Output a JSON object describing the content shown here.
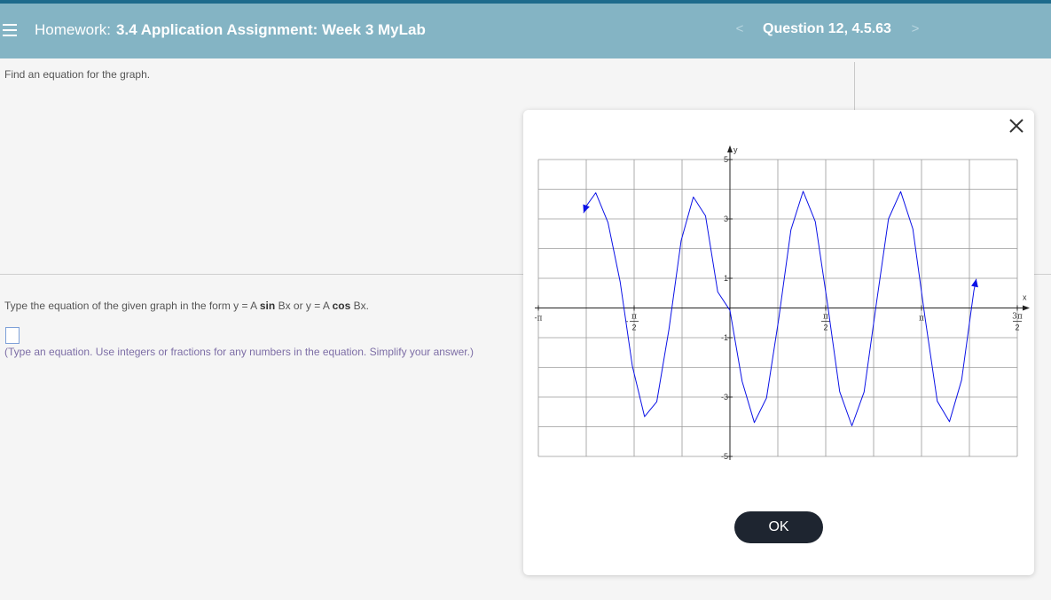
{
  "header": {
    "prefix": "Homework:",
    "assignment": "3.4 Application Assignment: Week 3 MyLab",
    "question": "Question 12, 4.5.63",
    "menu_icon": "hamburger-menu-icon",
    "prev_icon": "chevron-left-icon",
    "next_icon": "chevron-right-icon",
    "prev_glyph": "<",
    "next_glyph": ">"
  },
  "instruction": "Find an equation for the graph.",
  "prompt": {
    "before": "Type the equation of the given graph in the form y = A",
    "sin": "sin",
    "middle": "Bx or y = A",
    "cos": "cos",
    "after": "Bx."
  },
  "answer": {
    "value": ""
  },
  "hint": "(Type an equation. Use integers or fractions for any numbers in the equation. Simplify your answer.)",
  "modal": {
    "ok_label": "OK",
    "close_icon": "close-icon"
  },
  "colors": {
    "header": "#84b4c4",
    "curve": "#0b12e6",
    "ok_button": "#1e2530"
  },
  "chart_data": {
    "type": "line",
    "xlabel": "x",
    "ylabel": "y",
    "xlim": [
      "-π",
      "3π/2"
    ],
    "xlim_numeric": [
      -3.1416,
      4.7124
    ],
    "ylim": [
      -5,
      5
    ],
    "grid": true,
    "x_ticks": [
      {
        "value": -3.1416,
        "num": "π",
        "den": "",
        "sign": "-"
      },
      {
        "value": -1.5708,
        "num": "π",
        "den": "2",
        "sign": "-"
      },
      {
        "value": 1.5708,
        "num": "π",
        "den": "2",
        "sign": ""
      },
      {
        "value": 3.1416,
        "num": "π",
        "den": "",
        "sign": ""
      },
      {
        "value": 4.7124,
        "num": "3π",
        "den": "2",
        "sign": ""
      }
    ],
    "y_ticks": [
      {
        "value": 5,
        "label": "5"
      },
      {
        "value": 3,
        "label": "3"
      },
      {
        "value": 1,
        "label": "1"
      },
      {
        "value": -1,
        "label": "-1"
      },
      {
        "value": -3,
        "label": "-3"
      },
      {
        "value": -5,
        "label": "-5"
      }
    ],
    "series": [
      {
        "color": "#0b12e6",
        "x": [
          -2.4,
          -2.36,
          -2.2,
          -2.0,
          -1.8,
          -1.6,
          -1.4,
          -1.2,
          -1.0,
          -0.8,
          -0.6,
          -0.4,
          -0.2,
          0,
          0.2,
          0.4,
          0.6,
          0.8,
          1.0,
          1.2,
          1.4,
          1.6,
          1.8,
          2.0,
          2.2,
          2.4,
          2.6,
          2.8,
          3.0,
          3.2,
          3.4,
          3.6,
          3.8,
          4.0,
          4.04
        ],
        "y": [
          3.2,
          3.42,
          3.88,
          2.88,
          0.88,
          -1.96,
          -3.66,
          -3.16,
          -0.72,
          2.27,
          3.74,
          3.1,
          0.54,
          -0.08,
          -2.47,
          -3.86,
          -3.03,
          -0.37,
          2.63,
          3.93,
          2.91,
          0.14,
          -2.82,
          -3.97,
          -2.83,
          0.13,
          3.0,
          3.92,
          2.66,
          -0.33,
          -3.14,
          -3.83,
          -2.42,
          0.58,
          0.98
        ],
        "start_arrow": true,
        "end_arrow": true
      }
    ]
  }
}
